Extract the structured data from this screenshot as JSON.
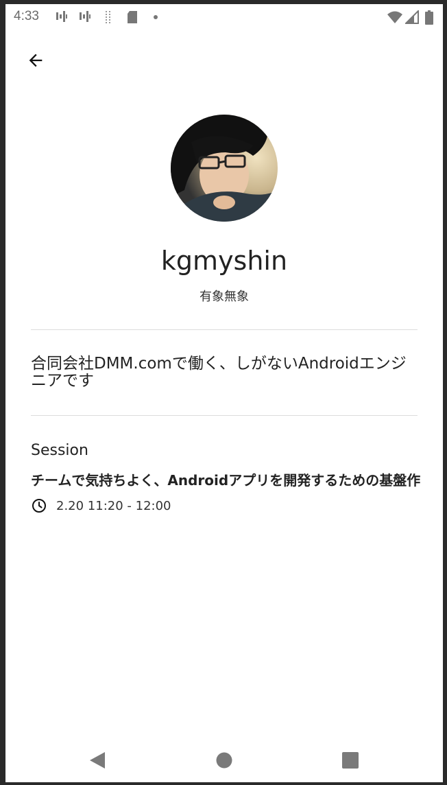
{
  "status_bar": {
    "time": "4:33",
    "icons": [
      "signal-bars-icon",
      "signal-bars-icon",
      "dotted-signal-icon",
      "sd-card-icon",
      "dot-icon",
      "wifi-icon",
      "cell-signal-icon",
      "battery-icon"
    ]
  },
  "top_bar": {
    "back_icon": "arrow-back-icon"
  },
  "speaker": {
    "name": "kgmyshin",
    "tagline": "有象無象",
    "bio": "合同会社DMM.comで働く、しがないAndroidエンジニアです"
  },
  "session": {
    "label": "Session",
    "title": "チームで気持ちよく、Androidアプリを開発するための基盤作",
    "time": "2.20 11:20 - 12:00",
    "time_icon": "clock-icon"
  },
  "nav_bar": {
    "back": "nav-back-icon",
    "home": "nav-home-icon",
    "recents": "nav-recents-icon"
  }
}
